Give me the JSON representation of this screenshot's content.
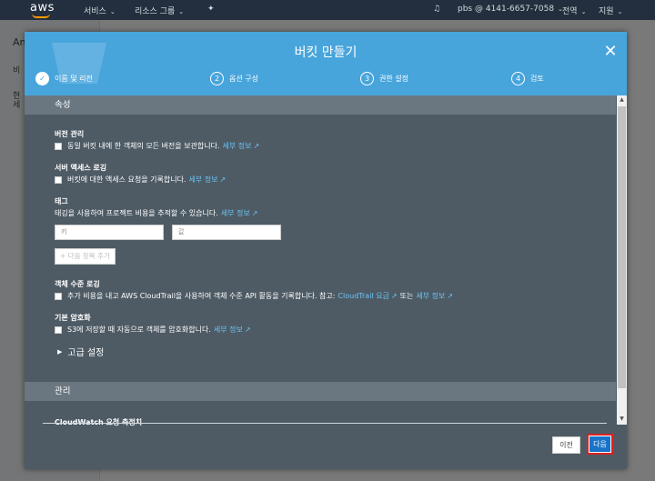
{
  "topnav": {
    "logo": "aws",
    "services": "서비스",
    "resource_groups": "리소스 그룹",
    "account": "pbs @ 4141-6657-7058",
    "region": "전역",
    "support": "지원"
  },
  "background": {
    "title_fragment": "An",
    "side_fragment": "비",
    "text_line1": "현",
    "text_line2": "세"
  },
  "modal": {
    "title": "버킷 만들기",
    "steps": [
      {
        "num": "✓",
        "label": "이름 및 리전"
      },
      {
        "num": "2",
        "label": "옵션 구성"
      },
      {
        "num": "3",
        "label": "권한 설정"
      },
      {
        "num": "4",
        "label": "검토"
      }
    ],
    "properties_header": "속성",
    "versioning": {
      "title": "버전 관리",
      "text": "동일 버킷 내에 한 객체의 모든 버전을 보관합니다.",
      "link": "세부 정보"
    },
    "server_logging": {
      "title": "서버 액세스 로깅",
      "text": "버킷에 대한 액세스 요청을 기록합니다.",
      "link": "세부 정보"
    },
    "tags": {
      "title": "태그",
      "text": "태깅을 사용하여 프로젝트 비용을 추적할 수 있습니다.",
      "link": "세부 정보",
      "key_placeholder": "키",
      "value_placeholder": "값",
      "add_label": "다음 항목 추가"
    },
    "object_logging": {
      "title": "객체 수준 로깅",
      "text": "추가 비용을 내고 AWS CloudTrail을 사용하여 객체 수준 API 활동을 기록합니다. 참고:",
      "link1": "CloudTrail 요금",
      "middle": "또는",
      "link2": "세부 정보"
    },
    "encryption": {
      "title": "기본 암호화",
      "text": "S3에 저장할 때 자동으로 객체를 암호화합니다.",
      "link": "세부 정보"
    },
    "advanced": "고급 설정",
    "management_header": "관리",
    "cloudwatch": "CloudWatch 요청 측정치",
    "buttons": {
      "prev": "이전",
      "next": "다음"
    }
  }
}
